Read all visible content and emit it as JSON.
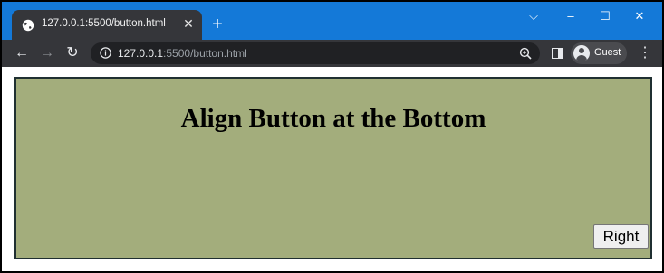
{
  "browser": {
    "tab": {
      "title": "127.0.0.1:5500/button.html",
      "close_glyph": "✕",
      "icon": "globe-icon"
    },
    "new_tab_glyph": "+",
    "window_controls": {
      "dropdown": "⌵",
      "minimize": "–",
      "maximize": "☐",
      "close": "✕"
    },
    "nav": {
      "back": "←",
      "forward": "→",
      "reload": "↻"
    },
    "address": {
      "host": "127.0.0.1",
      "path": ":5500/button.html"
    },
    "profile": {
      "label": "Guest"
    },
    "menu_glyph": "⋮",
    "colors": {
      "tab_strip": "#1479d8",
      "toolbar": "#35363a",
      "omnibox": "#202124"
    }
  },
  "page": {
    "heading": "Align Button at the Bottom",
    "button_label": "Right",
    "colors": {
      "container_bg": "#a3ad7c",
      "container_border": "#1f2f31"
    }
  }
}
